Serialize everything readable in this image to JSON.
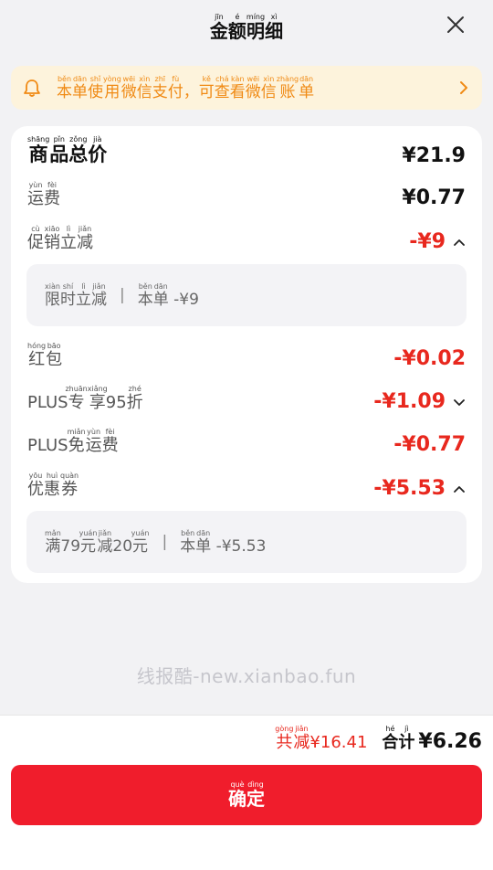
{
  "header": {
    "title": "金额明细",
    "title_pinyin": [
      "jīn",
      "é",
      "míng",
      "xì"
    ],
    "close_icon": "close-icon"
  },
  "notice": {
    "text": "本单使用微信支付，可查看微信账单",
    "icon": "bell-icon",
    "color": "#f08a14"
  },
  "breakdown": {
    "goods_total_label": "商品总价",
    "goods_total_value": "¥21.9",
    "shipping_label": "运费",
    "shipping_value": "¥0.77",
    "promo_label": "促销立减",
    "promo_value": "-¥9",
    "promo_detail_left": "限时立减",
    "promo_detail_right": "本单 -¥9",
    "redpacket_label": "红包",
    "redpacket_value": "-¥0.02",
    "plus_discount_label": "PLUS专享95折",
    "plus_discount_value": "-¥1.09",
    "plus_shipping_label": "PLUS免运费",
    "plus_shipping_value": "-¥0.77",
    "coupon_label": "优惠券",
    "coupon_value": "-¥5.53",
    "coupon_detail_left": "满79元减20元",
    "coupon_detail_right": "本单 -¥5.53"
  },
  "watermark": "线报酷-new.xianbao.fun",
  "footer": {
    "saved_label": "共减",
    "saved_value": "¥16.41",
    "sum_label": "合计",
    "sum_value": "¥6.26",
    "confirm_label": "确定"
  },
  "colors": {
    "accent": "#f01d2c",
    "discount": "#e8281e",
    "notice_bg": "#fdf3dc"
  }
}
